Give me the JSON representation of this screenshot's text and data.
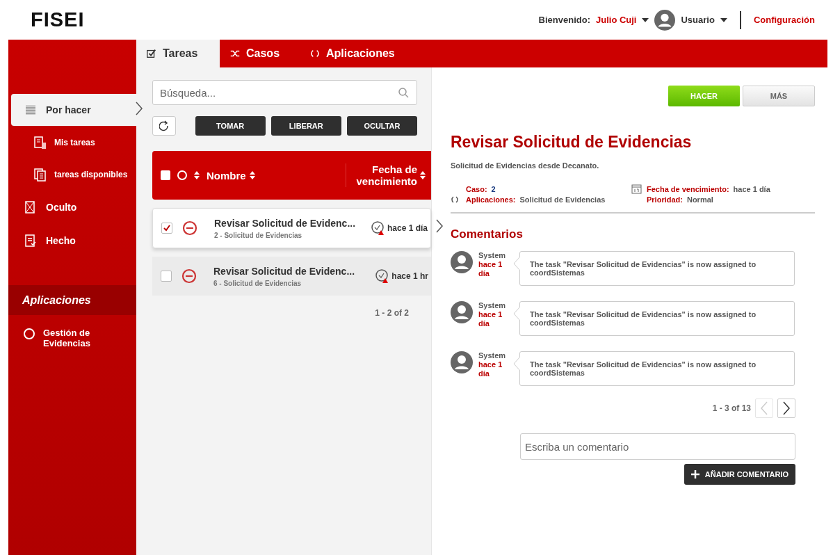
{
  "header": {
    "logo": "FISEI",
    "welcome_label": "Bienvenido:",
    "user_name": "Julio Cuji",
    "role": "Usuario",
    "settings_link": "Configuración"
  },
  "sidebar": {
    "items": [
      {
        "label": "Por hacer",
        "selected": true,
        "children": [
          {
            "label": "Mis tareas",
            "selected": false
          },
          {
            "label": "tareas disponibles",
            "selected": false
          }
        ]
      },
      {
        "label": "Oculto",
        "selected": false
      },
      {
        "label": "Hecho",
        "selected": false
      }
    ],
    "apps_heading": "Aplicaciones",
    "apps": [
      {
        "label": "Gestión de Evidencias"
      }
    ]
  },
  "tabs": [
    {
      "label": "Tareas",
      "selected": true
    },
    {
      "label": "Casos",
      "selected": false
    },
    {
      "label": "Aplicaciones",
      "selected": false
    }
  ],
  "search": {
    "placeholder": "Búsqueda..."
  },
  "actions": [
    "TOMAR",
    "LIBERAR",
    "OCULTAR"
  ],
  "table": {
    "select_all_checked": false,
    "columns": [
      "Nombre",
      "Fecha de vencimiento"
    ],
    "rows": [
      {
        "checked": true,
        "selected": true,
        "name": "Revisar Solicitud de Evidenc...",
        "detail": "2 - Solicitud de Evidencias",
        "due": "hace 1 día"
      },
      {
        "checked": false,
        "selected": false,
        "name": "Revisar Solicitud de Evidenc...",
        "detail": "6 - Solicitud de Evidencias",
        "due": "hace 1 hr"
      }
    ],
    "pagination": "1 - 2 of 2"
  },
  "detail": {
    "buttons": [
      "HACER",
      "MÁS"
    ],
    "title": "Revisar Solicitud de Evidencias",
    "description": "Solicitud de Evidencias desde Decanato.",
    "fields": [
      {
        "label": "Caso:",
        "value": "2"
      },
      {
        "label": "Fecha de vencimiento:",
        "value": "hace 1 día"
      },
      {
        "label": "Aplicaciones:",
        "value": "Solicitud de Evidencias"
      },
      {
        "label": "Prioridad:",
        "value": "Normal"
      }
    ],
    "comments_heading": "Comentarios",
    "comments": [
      {
        "author": "System",
        "time": "hace 1 día",
        "text": "The task \"Revisar Solicitud de Evidencias\" is now assigned to coordSistemas"
      },
      {
        "author": "System",
        "time": "hace 1 día",
        "text": "The task \"Revisar Solicitud de Evidencias\" is now assigned to coordSistemas"
      },
      {
        "author": "System",
        "time": "hace 1 día",
        "text": "The task \"Revisar Solicitud de Evidencias\" is now assigned to coordSistemas"
      }
    ],
    "pagination": "1 - 3 of 13",
    "prev_disabled": true,
    "next_disabled": false,
    "comment_placeholder": "Escriba un comentario",
    "add_button": "AÑADIR COMENTARIO"
  }
}
